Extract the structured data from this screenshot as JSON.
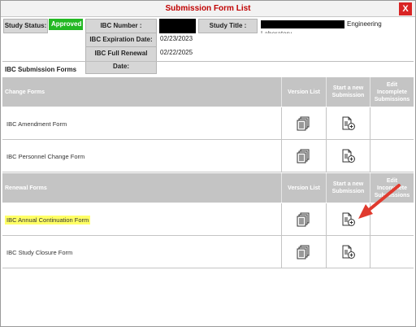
{
  "window": {
    "title": "Submission Form List",
    "close_label": "X"
  },
  "study_info": {
    "status_label": "Study Status:",
    "status_value": "Approved",
    "ibc_number_label": "IBC Number :",
    "study_title_label": "Study Title :",
    "study_title_visible_text": "Engineering",
    "study_title_cut_text": "Laboratory",
    "ibc_expiration_label": "IBC Expiration Date:",
    "ibc_expiration_value": "02/23/2023",
    "ibc_renewal_label": "IBC Full Renewal Date:",
    "ibc_renewal_value": "02/22/2025"
  },
  "submission_forms_caption": "IBC Submission Forms",
  "columns": {
    "version_list": "Version List",
    "start_new_line1": "Start a new",
    "start_new_line2": "Submission",
    "edit_incomplete_line1": "Edit",
    "edit_incomplete_line2": "Incomplete",
    "edit_incomplete_line3": "Submissions"
  },
  "change_forms": {
    "header": "Change Forms",
    "rows": [
      {
        "name": "IBC Amendment Form",
        "highlighted": false
      },
      {
        "name": "IBC Personnel Change Form",
        "highlighted": false
      }
    ]
  },
  "renewal_forms": {
    "header": "Renewal Forms",
    "rows": [
      {
        "name": "IBC Annual Continuation Form",
        "highlighted": true
      },
      {
        "name": "IBC Study Closure Form",
        "highlighted": false
      }
    ]
  },
  "icons": {
    "version_list": "document-stack-icon",
    "start_new": "new-document-plus-icon",
    "annotation": "red-arrow-annotation"
  },
  "colors": {
    "title_text": "#c00000",
    "close_button": "#d92424",
    "approved_badge": "#23b823",
    "section_header": "#c4c4c4",
    "highlight": "#ffff66",
    "arrow": "#e03a2e"
  }
}
